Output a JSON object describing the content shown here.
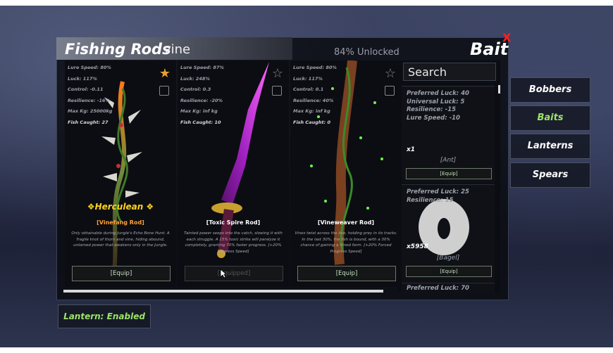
{
  "header": {
    "title": "Fishing Rods",
    "search_value": "vine",
    "unlocked": "84% Unlocked",
    "bait_title": "Bait",
    "close": "X"
  },
  "rods": [
    {
      "stats": [
        "Lure Speed: 80%",
        "Luck: 117%",
        "Control: -0.11",
        "Resilience: -16%",
        "Max Kg: 25000kg"
      ],
      "caught": "Fish Caught: 27",
      "badge": "❖Herculean ❖",
      "name": "[Vinefang Rod]",
      "desc": "Only obtainable during Jungle's Echo Bone Hunt. A fragile knot of thorn and vine, hiding abound, untamed power that awakens only in the Jungle.",
      "equip": "[Equip]",
      "favorite": true
    },
    {
      "stats": [
        "Lure Speed: 87%",
        "Luck: 248%",
        "Control: 0.3",
        "Resilience: -20%",
        "Max Kg: inf kg"
      ],
      "caught": "Fish Caught: 10",
      "name": "[Toxic Spire Rod]",
      "desc": "Tainted power seeps into the catch, slowing it with each struggle. A 15% toxic strike will paralyze it completely, granting 70% faster progress. [+20% Progress Speed]",
      "equip": "[Equipped]",
      "favorite": false
    },
    {
      "stats": [
        "Lure Speed: 80%",
        "Luck: 117%",
        "Control: 0.1",
        "Resilience: 40%",
        "Max Kg: inf kg"
      ],
      "caught": "Fish Caught: 0",
      "name": "[Vineweaver Rod]",
      "desc": "Vines twist across the line, holding prey in its tracks. In the last 30%, the fish is bound, with a 30% chance of gaining a Vined form. [+20% Forced Progress Speed]",
      "equip": "[Equip]",
      "favorite": false
    }
  ],
  "bait": {
    "search_placeholder": "Search",
    "items": [
      {
        "stats": [
          "Preferred Luck: 40",
          "Universal Luck: 5",
          "Resilience: -15",
          "Lure Speed: -10"
        ],
        "count": "x1",
        "name": "[Ant]",
        "equip": "[Equip]"
      },
      {
        "stats": [
          "Preferred Luck: 25",
          "Resilience: 15"
        ],
        "count": "x5958",
        "name": "[Bagel]",
        "equip": "[Equip]"
      },
      {
        "stats": [
          "Preferred Luck: 70"
        ]
      }
    ]
  },
  "side": {
    "bobbers": "Bobbers",
    "baits": "Baits",
    "lanterns": "Lanterns",
    "spears": "Spears"
  },
  "lantern": "Lantern: Enabled",
  "colors": {
    "accent": "#9de36a",
    "rarity": "#ffd21f",
    "rod_name": "#ffa23a",
    "close": "#ff2020"
  }
}
